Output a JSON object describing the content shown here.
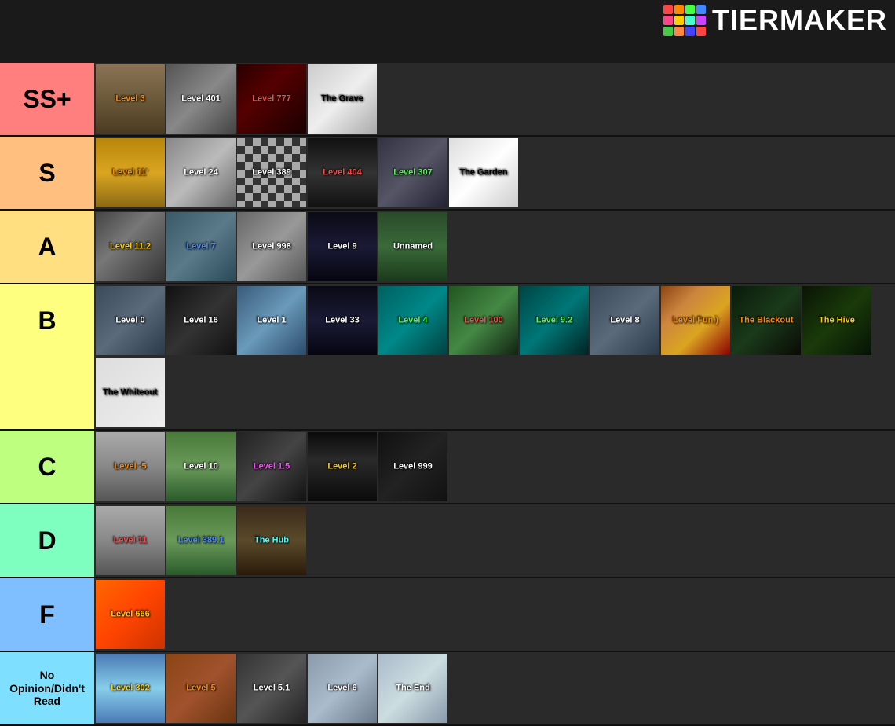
{
  "logo": {
    "text": "TiERMAKER",
    "colors": [
      "#ff4444",
      "#ff8800",
      "#ffcc00",
      "#44ff44",
      "#4488ff",
      "#cc44ff",
      "#ff4488",
      "#44ffcc",
      "#8844ff",
      "#ff8844",
      "#44cc44",
      "#4444ff"
    ]
  },
  "tiers": [
    {
      "id": "ss",
      "label": "SS+",
      "color": "#ff7f7f",
      "items": [
        {
          "label": "Level 3",
          "labelColor": "#ff8800",
          "bg": "bg-corridor"
        },
        {
          "label": "Level 401",
          "labelColor": "#fff",
          "bg": "bg-gray"
        },
        {
          "label": "Level 777",
          "labelColor": "#ff4444",
          "bg": "bg-red-dark"
        },
        {
          "label": "The Grave",
          "labelColor": "#fff",
          "bg": "bg-white-gray"
        }
      ]
    },
    {
      "id": "s",
      "label": "S",
      "color": "#ffbf7f",
      "items": [
        {
          "label": "Level 11'",
          "labelColor": "#ff8800",
          "bg": "bg-yellow-hall"
        },
        {
          "label": "Level 24",
          "labelColor": "#fff",
          "bg": "bg-light-gray"
        },
        {
          "label": "Level 389",
          "labelColor": "#fff",
          "bg": "bg-checker"
        },
        {
          "label": "Level 404",
          "labelColor": "#ff4444",
          "bg": "bg-dark-corridor"
        },
        {
          "label": "Level 307",
          "labelColor": "#44ff44",
          "bg": "bg-store"
        },
        {
          "label": "The Garden",
          "labelColor": "#fff",
          "bg": "bg-white"
        }
      ]
    },
    {
      "id": "a",
      "label": "A",
      "color": "#ffdf7f",
      "items": [
        {
          "label": "Level 11.2",
          "labelColor": "#ffcc00",
          "bg": "bg-grid-building"
        },
        {
          "label": "Level 7",
          "labelColor": "#4488ff",
          "bg": "bg-blue-gray"
        },
        {
          "label": "Level 998",
          "labelColor": "#fff",
          "bg": "bg-concrete"
        },
        {
          "label": "Level 9",
          "labelColor": "#fff",
          "bg": "bg-dark-hall"
        },
        {
          "label": "Unnamed",
          "labelColor": "#fff",
          "bg": "bg-green-hall"
        }
      ]
    },
    {
      "id": "b",
      "label": "B",
      "color": "#ffff7f",
      "items_row1": [
        {
          "label": "Level 0",
          "labelColor": "#fff",
          "bg": "bg-office"
        },
        {
          "label": "Level 16",
          "labelColor": "#fff",
          "bg": "bg-dark"
        },
        {
          "label": "Level 1",
          "labelColor": "#fff",
          "bg": "bg-blue-gray"
        },
        {
          "label": "Level 33",
          "labelColor": "#fff",
          "bg": "bg-dark-hall"
        },
        {
          "label": "Level 4",
          "labelColor": "#44ff44",
          "bg": "bg-cyan-aqua"
        },
        {
          "label": "Level 100",
          "labelColor": "#ff4444",
          "bg": "bg-outdoor"
        },
        {
          "label": "Level 9.2",
          "labelColor": "#44ff44",
          "bg": "bg-cyan-aqua"
        },
        {
          "label": "Level 8",
          "labelColor": "#fff",
          "bg": "bg-office"
        },
        {
          "label": "Level Fun )",
          "labelColor": "#ff8800",
          "bg": "bg-colorful"
        },
        {
          "label": "The Blackout",
          "labelColor": "#ff8800",
          "bg": "bg-dark-forest"
        },
        {
          "label": "The Hive",
          "labelColor": "#ffcc00",
          "bg": "bg-dark-forest"
        }
      ],
      "items_row2": [
        {
          "label": "The Whiteout",
          "labelColor": "#000",
          "bg": "bg-white-room"
        }
      ]
    },
    {
      "id": "c",
      "label": "C",
      "color": "#bfff7f",
      "items": [
        {
          "label": "Level -5",
          "labelColor": "#ff8800",
          "bg": "bg-city"
        },
        {
          "label": "Level 10",
          "labelColor": "#fff",
          "bg": "bg-outdoor"
        },
        {
          "label": "Level 1.5",
          "labelColor": "#ff44ff",
          "bg": "bg-dark"
        },
        {
          "label": "Level 2",
          "labelColor": "#ffcc00",
          "bg": "bg-tunnel"
        },
        {
          "label": "Level 999",
          "labelColor": "#fff",
          "bg": "bg-dark"
        }
      ]
    },
    {
      "id": "d",
      "label": "D",
      "color": "#7fffbf",
      "items": [
        {
          "label": "Level 11",
          "labelColor": "#ff4444",
          "bg": "bg-city"
        },
        {
          "label": "Level 389.1",
          "labelColor": "#4488ff",
          "bg": "bg-outdoor"
        },
        {
          "label": "The Hub",
          "labelColor": "#44ffff",
          "bg": "bg-underground"
        }
      ]
    },
    {
      "id": "f",
      "label": "F",
      "color": "#7fbfff",
      "items": [
        {
          "label": "Level 666",
          "labelColor": "#ffcc00",
          "bg": "bg-orange"
        }
      ]
    },
    {
      "id": "no",
      "label": "No Opinion/Didn't Read",
      "color": "#7fdfff",
      "items": [
        {
          "label": "Level 302",
          "labelColor": "#ffcc00",
          "bg": "bg-sky"
        },
        {
          "label": "Level 5",
          "labelColor": "#ff8800",
          "bg": "bg-wooden"
        },
        {
          "label": "Level 5.1",
          "labelColor": "#fff",
          "bg": "bg-vending"
        },
        {
          "label": "Level 6",
          "labelColor": "#fff",
          "bg": "bg-office-bright"
        },
        {
          "label": "The End",
          "labelColor": "#fff",
          "bg": "bg-end-room"
        }
      ]
    }
  ]
}
